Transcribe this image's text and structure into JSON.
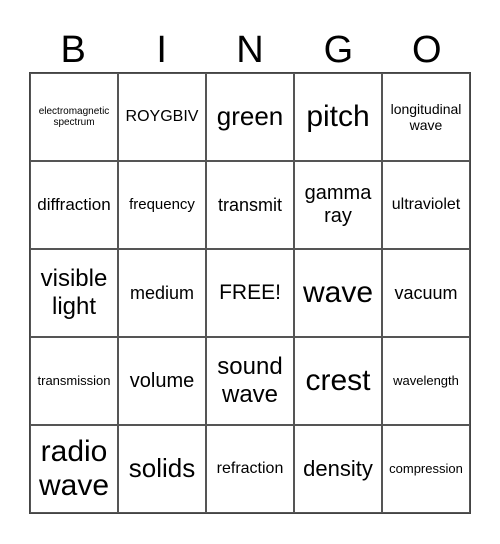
{
  "header": [
    "B",
    "I",
    "N",
    "G",
    "O"
  ],
  "cells": [
    "electromagnetic spectrum",
    "ROYGBIV",
    "green",
    "pitch",
    "longitudinal wave",
    "diffraction",
    "frequency",
    "transmit",
    "gamma ray",
    "ultraviolet",
    "visible light",
    "medium",
    "FREE!",
    "wave",
    "vacuum",
    "transmission",
    "volume",
    "sound wave",
    "crest",
    "wavelength",
    "radio wave",
    "solids",
    "refraction",
    "density",
    "compression"
  ]
}
